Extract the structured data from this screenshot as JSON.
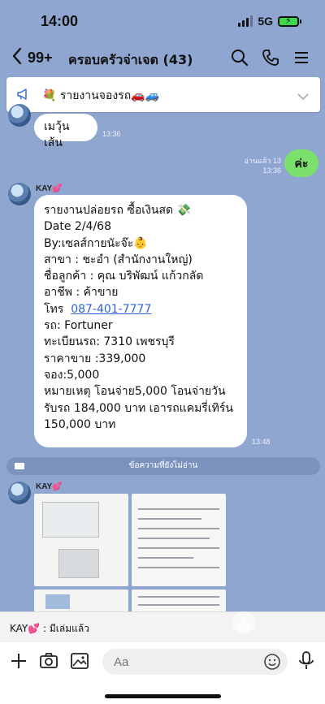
{
  "status": {
    "time": "14:00",
    "network": "5G"
  },
  "nav": {
    "back_count": "99+",
    "title": "ครอบครัวจ่าเจต (43)"
  },
  "announcement": {
    "text": "💐 รายงานจองรถ🚗🚙"
  },
  "messages": {
    "m1": {
      "text": "เมวุ้นเส้น",
      "time": "13:36"
    },
    "m2": {
      "read": "อ่านแล้ว 13",
      "time": "13:36",
      "text": "ค่ะ"
    },
    "m3": {
      "sender": "KAY",
      "heart": "💕",
      "lines": [
        "รายงานปล่อยรถ ซื้อเงินสด 💸",
        "Date 2/4/68",
        "By:เซลส์กายนัะจ๊ะ👶",
        "สาขา : ชะอำ (สำนักงานใหญ่)",
        "ชื่อลูกค้า : คุณ บริพัฒน์ แก้วกลัด",
        "อาชีพ : ค้าขาย",
        "รถ:  Fortuner",
        "ทะเบียนรถ:  7310 เพชรบุรี",
        "ราคาขาย :339,000",
        "จอง:5,000",
        "หมายเหตุ โอนจ่าย5,000 โอนจ่ายวัน",
        "รับรถ 184,000 บาท เอารถแคมรี่เทิร์น",
        "150,000 บาท"
      ],
      "phone_label": "โทร",
      "phone": "087-401-7777",
      "time": "13:48"
    },
    "unread_divider": "ข้อความที่ยังไม่อ่าน",
    "m4": {
      "sender": "KAY",
      "heart": "💕"
    }
  },
  "preview": {
    "sender": "KAY",
    "heart": "💕",
    "text": " : มีเล่มแล้ว"
  },
  "input": {
    "placeholder": "Aa"
  },
  "colors": {
    "background": "#8fa6d1",
    "my_bubble": "#7be06c",
    "link": "#2f64d6"
  }
}
